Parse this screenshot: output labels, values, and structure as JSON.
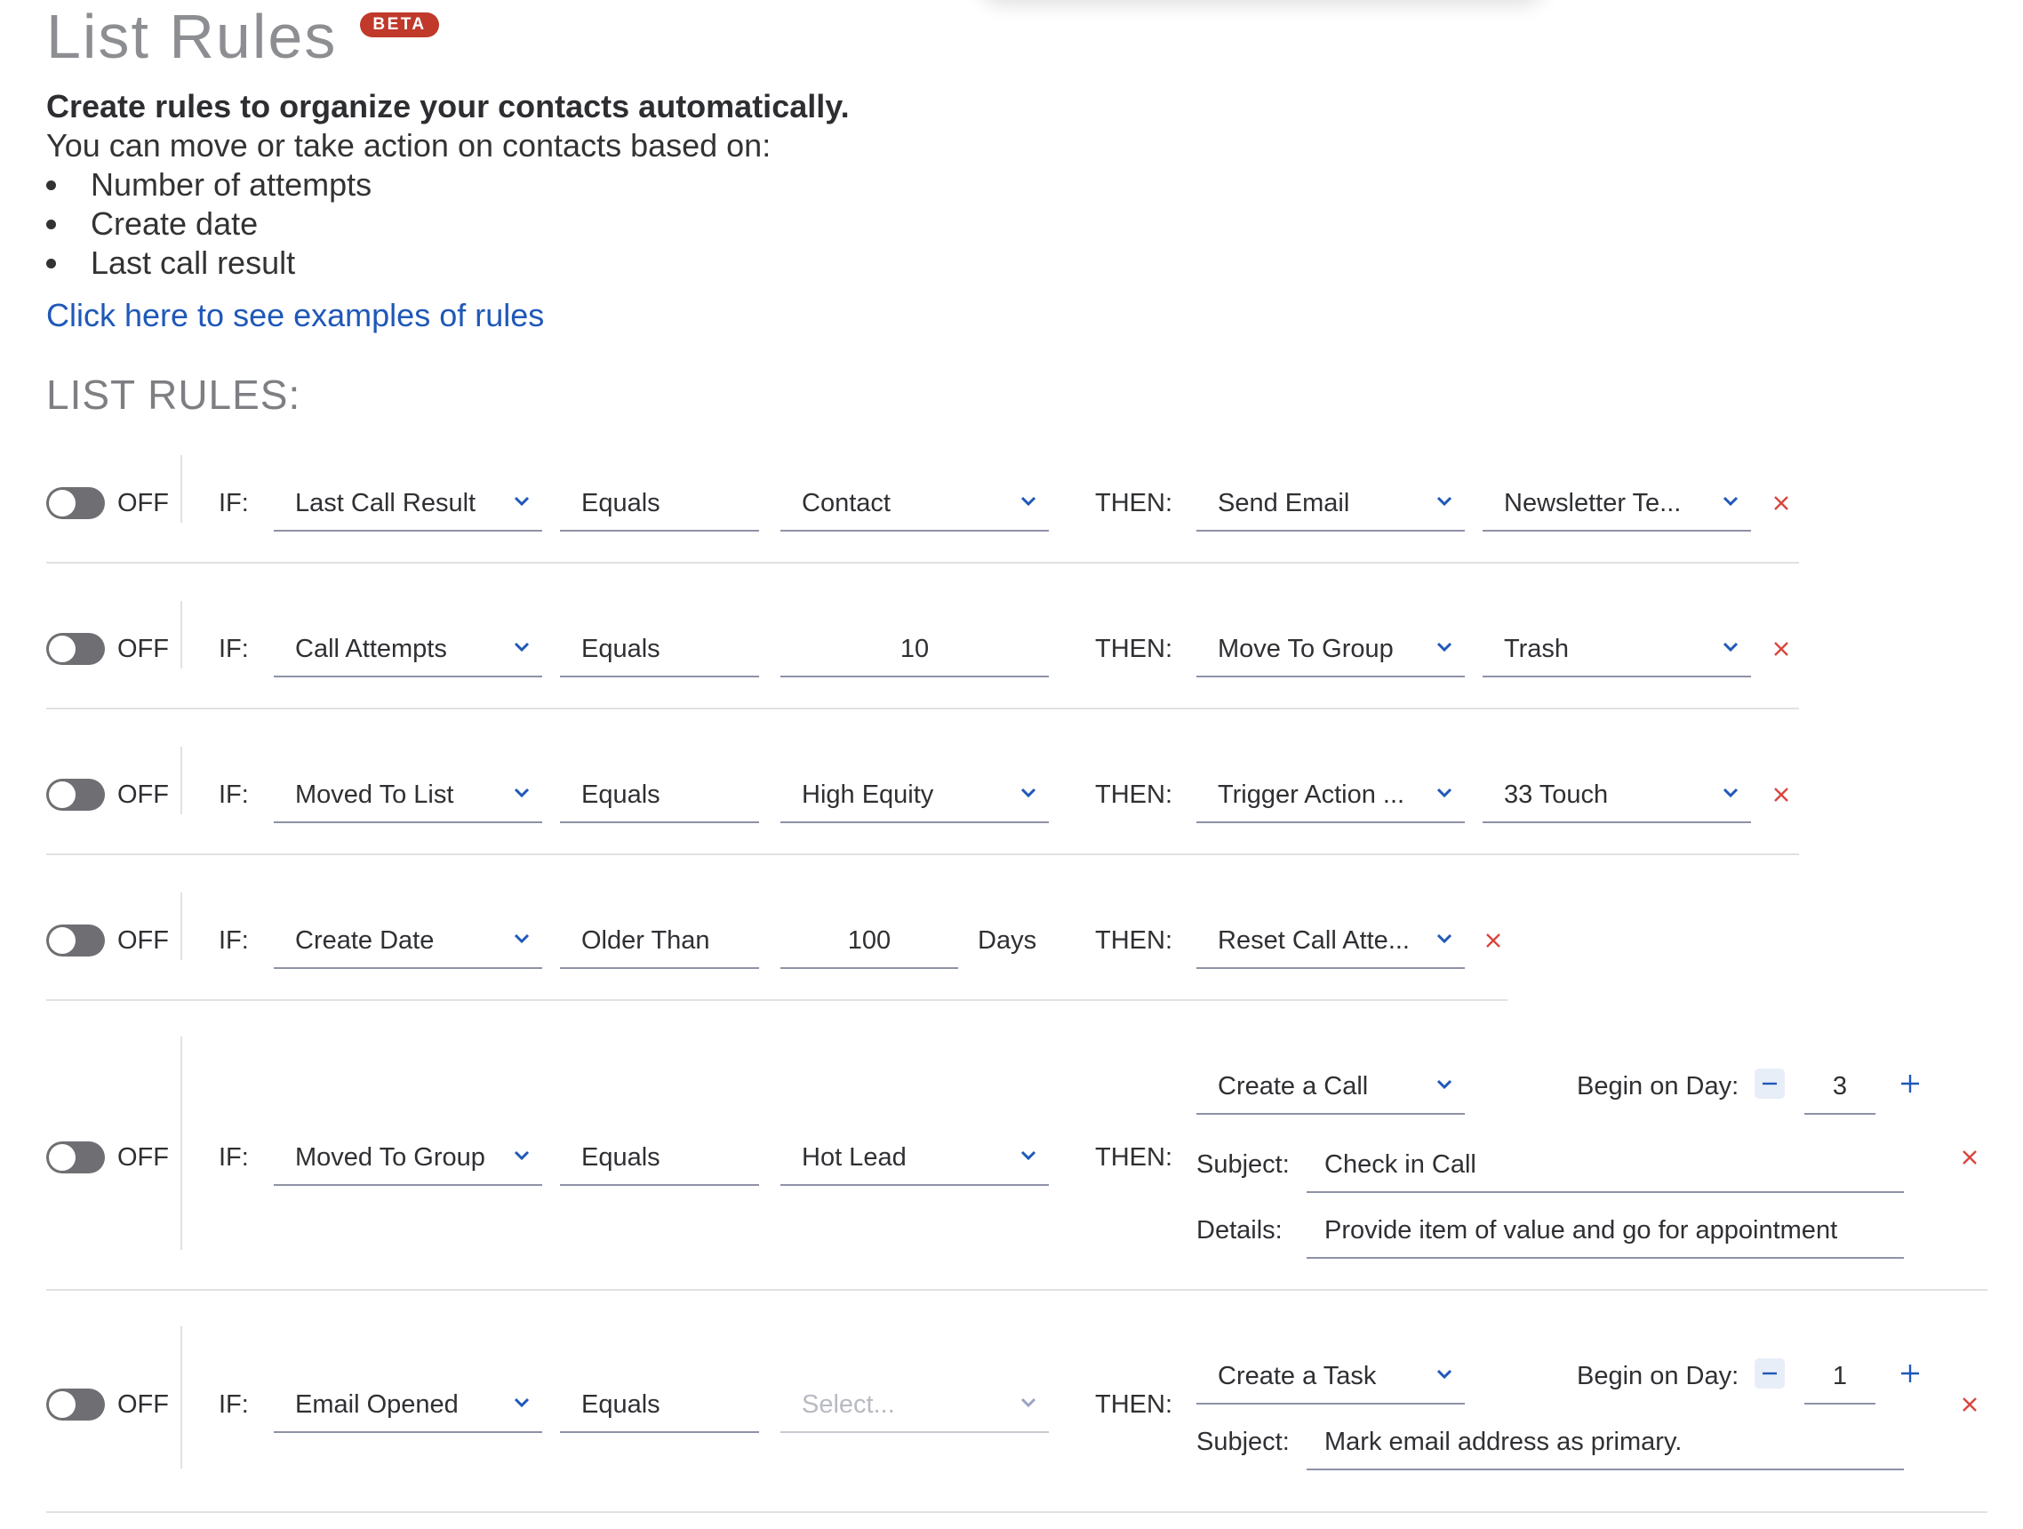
{
  "page": {
    "title": "List Rules",
    "badge": "BETA",
    "intro_heading": "Create rules to organize your contacts automatically.",
    "intro_text": "You can move or take action on contacts based on:",
    "bullets": [
      "Number of attempts",
      "Create date",
      "Last call result"
    ],
    "examples_link": "Click here to see examples of rules",
    "section_heading": "LIST RULES:"
  },
  "labels": {
    "off": "OFF",
    "if": "IF:",
    "then": "THEN:",
    "days": "Days",
    "begin_on_day": "Begin on Day:",
    "subject": "Subject:",
    "details": "Details:"
  },
  "colors": {
    "accent": "#1f58b8",
    "badge": "#c0392b",
    "delete": "#d9453d",
    "toggle_off": "#6f6f73"
  },
  "icons": {
    "dropdown": "chevron-down-icon",
    "delete": "close-icon",
    "minus": "minus-icon",
    "plus": "plus-icon"
  },
  "rules": [
    {
      "state": "OFF",
      "condition_field": "Last Call Result",
      "operator": "Equals",
      "value": "Contact",
      "action": "Send Email",
      "target": "Newsletter Te..."
    },
    {
      "state": "OFF",
      "condition_field": "Call Attempts",
      "operator": "Equals",
      "value": "10",
      "action": "Move To Group",
      "target": "Trash"
    },
    {
      "state": "OFF",
      "condition_field": "Moved To List",
      "operator": "Equals",
      "value": "High Equity",
      "action": "Trigger Action ...",
      "target": "33 Touch"
    },
    {
      "state": "OFF",
      "condition_field": "Create Date",
      "operator": "Older Than",
      "value": "100",
      "unit": "Days",
      "action": "Reset Call Atte..."
    },
    {
      "state": "OFF",
      "condition_field": "Moved To Group",
      "operator": "Equals",
      "value": "Hot Lead",
      "action": "Create a Call",
      "begin_day": "3",
      "subject": "Check in Call",
      "details": "Provide item of value and go for appointment"
    },
    {
      "state": "OFF",
      "condition_field": "Email Opened",
      "operator": "Equals",
      "value_placeholder": "Select...",
      "action": "Create a Task",
      "begin_day": "1",
      "subject": "Mark email address as primary."
    }
  ]
}
